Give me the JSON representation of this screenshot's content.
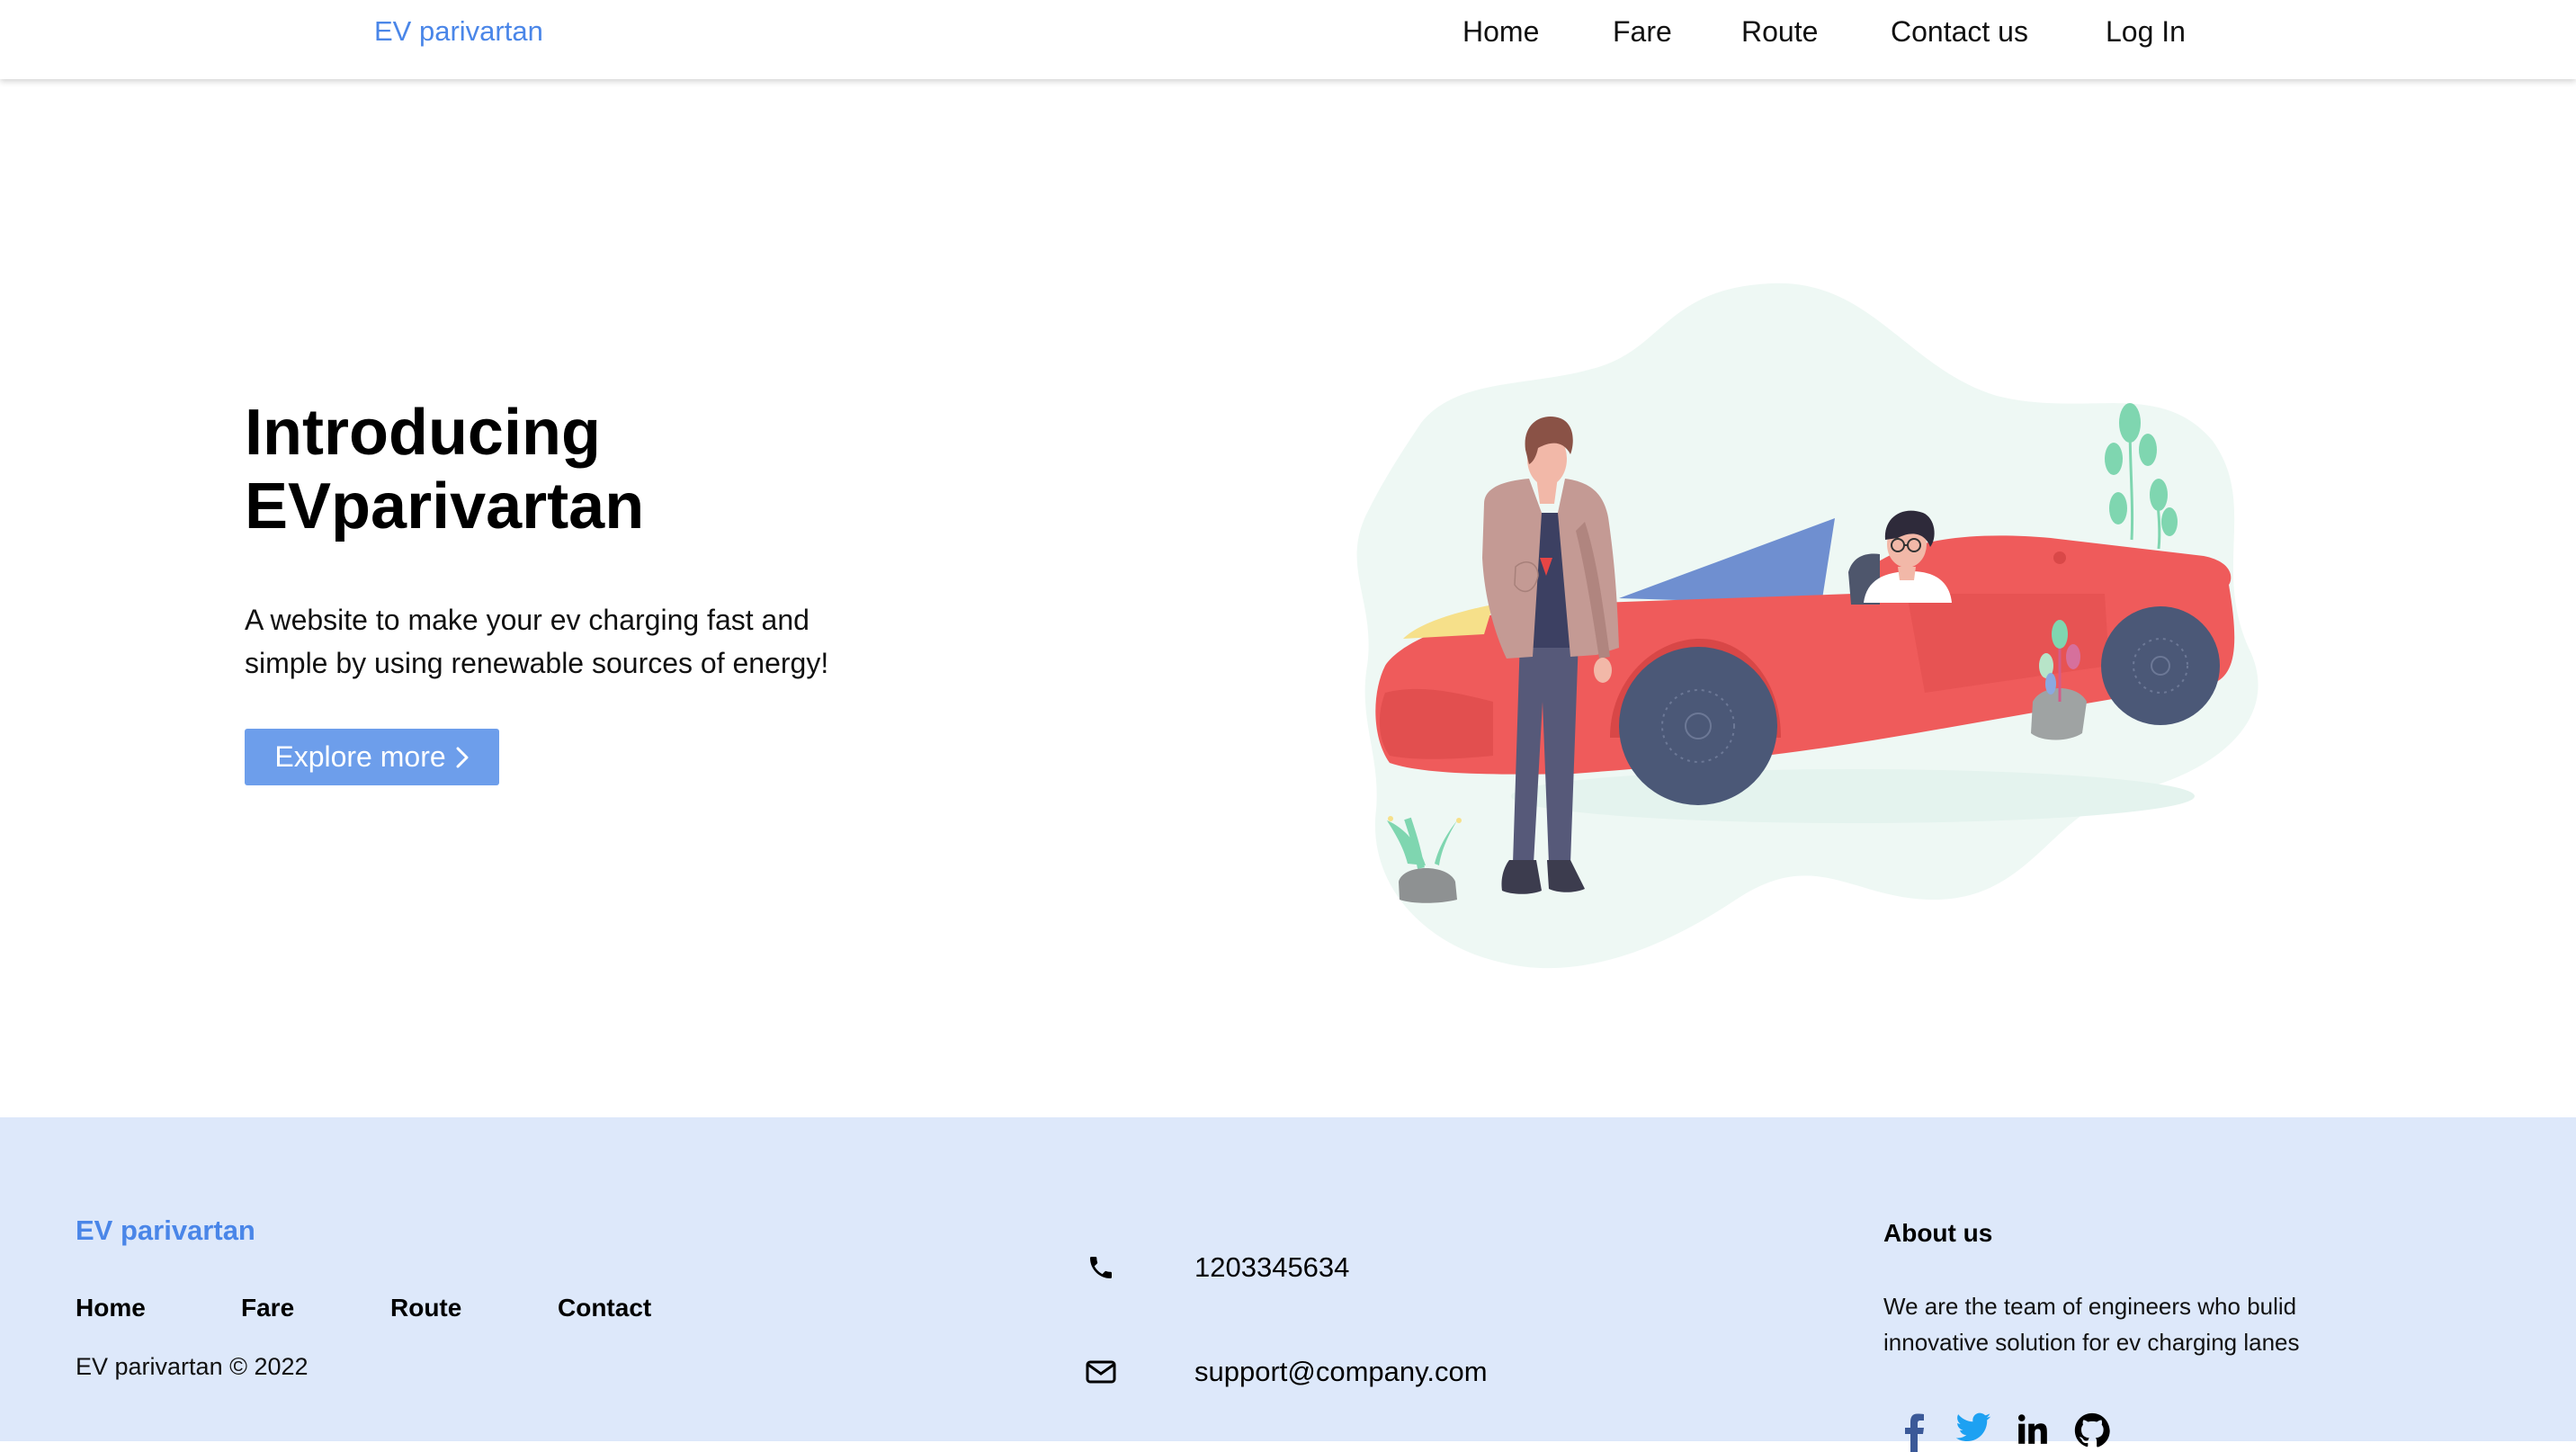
{
  "navbar": {
    "brand": "EV parivartan",
    "links": [
      {
        "label": "Home"
      },
      {
        "label": "Fare"
      },
      {
        "label": "Route"
      },
      {
        "label": "Contact us"
      },
      {
        "label": "Log In"
      }
    ]
  },
  "hero": {
    "title_line1": "Introducing",
    "title_line2": "EVparivartan",
    "description": "A website to make your ev charging fast and simple by using renewable sources of energy!",
    "button_label": "Explore more",
    "illustration_icon": "person-with-red-convertible-illustration"
  },
  "footer": {
    "brand": "EV parivartan",
    "links": [
      {
        "label": "Home"
      },
      {
        "label": "Fare"
      },
      {
        "label": "Route"
      },
      {
        "label": "Contact"
      }
    ],
    "copyright": "EV parivartan © 2022",
    "phone": "1203345634",
    "email": "support@company.com",
    "about_title": "About us",
    "about_text": "We are the team of engineers who bulid innovative solution for ev charging lanes",
    "social_icons": [
      "facebook-icon",
      "twitter-icon",
      "linkedin-icon",
      "github-icon"
    ]
  },
  "colors": {
    "brand_blue": "#4a86e8",
    "button_blue": "#6d9eeb",
    "footer_bg": "#dde8fa",
    "car_red": "#ef5b5b"
  }
}
